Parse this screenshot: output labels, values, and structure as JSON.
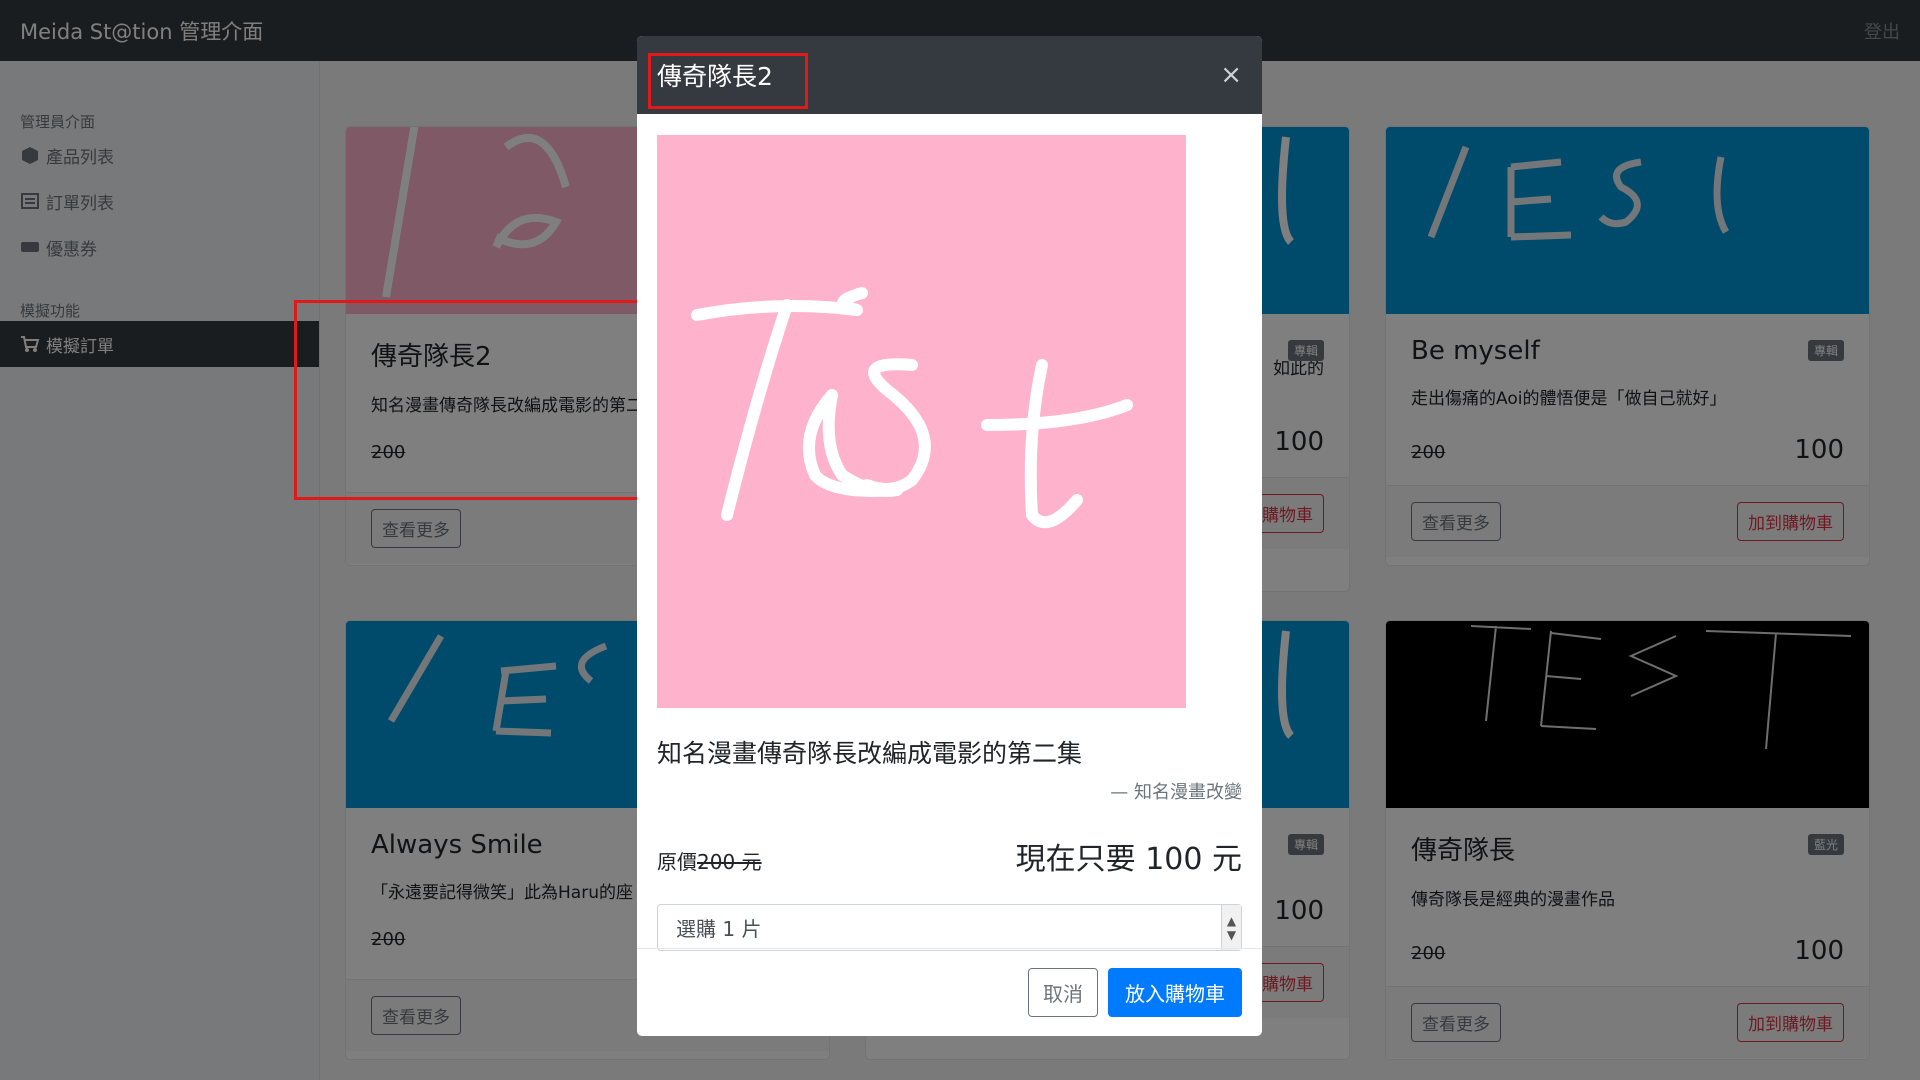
{
  "navbar": {
    "brand": "Meida St@tion 管理介面",
    "logout": "登出"
  },
  "sidebar": {
    "heading_admin": "管理員介面",
    "items_admin": [
      {
        "label": "產品列表",
        "icon": "box-icon"
      },
      {
        "label": "訂單列表",
        "icon": "list-icon"
      },
      {
        "label": "優惠券",
        "icon": "ticket-icon"
      }
    ],
    "heading_sim": "模擬功能",
    "item_sim": {
      "label": "模擬訂單",
      "icon": "cart-icon"
    }
  },
  "cards": [
    {
      "title": "傳奇隊長2",
      "desc": "知名漫畫傳奇隊長改編成電影的第二集",
      "old_price": "200",
      "new_price": "",
      "badge": "",
      "view_label": "查看更多",
      "cart_label": ""
    },
    {
      "title": "",
      "desc": "如此的",
      "old_price": "",
      "new_price": "100",
      "badge": "專輯",
      "view_label": "",
      "cart_label": "購物車"
    },
    {
      "title": "Be myself",
      "desc": "走出傷痛的Aoi的體悟便是「做自己就好」",
      "old_price": "200",
      "new_price": "100",
      "badge": "專輯",
      "view_label": "查看更多",
      "cart_label": "加到購物車"
    },
    {
      "title": "Always Smile",
      "desc": "「永遠要記得微笑」此為Haru的座",
      "old_price": "200",
      "new_price": "",
      "badge": "",
      "view_label": "查看更多",
      "cart_label": ""
    },
    {
      "title": "",
      "desc": "",
      "old_price": "",
      "new_price": "100",
      "badge": "專輯",
      "view_label": "",
      "cart_label": "購物車"
    },
    {
      "title": "傳奇隊長",
      "desc": "傳奇隊長是經典的漫畫作品",
      "old_price": "200",
      "new_price": "100",
      "badge": "藍光",
      "view_label": "查看更多",
      "cart_label": "加到購物車"
    }
  ],
  "modal": {
    "title": "傳奇隊長2",
    "close": "×",
    "image_text": "Test",
    "lead": "知名漫畫傳奇隊長改編成電影的第二集",
    "quote": "— 知名漫畫改變",
    "original_price_label": "原價",
    "original_price": "200 元",
    "now_price": "現在只要 100 元",
    "select_value": "選購 1 片",
    "cancel_label": "取消",
    "add_label": "放入購物車"
  },
  "colors": {
    "navbar": "#343a40",
    "primary": "#007bff",
    "danger": "#dc3545",
    "highlight": "#e0191b",
    "pink_img": "#ffb2cb",
    "blue_img": "#0096d6"
  }
}
